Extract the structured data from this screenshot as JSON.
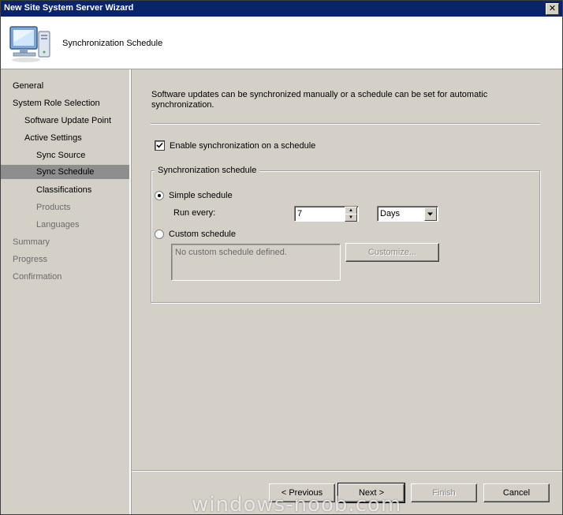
{
  "window": {
    "title": "New Site System Server Wizard",
    "close_glyph": "✕"
  },
  "header": {
    "title": "Synchronization Schedule",
    "icon": "computer-icon"
  },
  "nav": [
    {
      "label": "General",
      "state": "normal"
    },
    {
      "label": "System Role Selection",
      "state": "normal"
    },
    {
      "label": "Software Update Point",
      "state": "normal"
    },
    {
      "label": "Active Settings",
      "state": "normal"
    },
    {
      "label": "Sync Source",
      "state": "normal"
    },
    {
      "label": "Sync Schedule",
      "state": "selected"
    },
    {
      "label": "Classifications",
      "state": "normal"
    },
    {
      "label": "Products",
      "state": "dim"
    },
    {
      "label": "Languages",
      "state": "dim"
    },
    {
      "label": "Summary",
      "state": "dim"
    },
    {
      "label": "Progress",
      "state": "dim"
    },
    {
      "label": "Confirmation",
      "state": "dim"
    }
  ],
  "content": {
    "intro": "Software updates can be synchronized manually or a schedule can be set for automatic synchronization.",
    "enable_sync": {
      "label": "Enable synchronization on a schedule",
      "checked": true
    },
    "group_title": "Synchronization schedule",
    "simple": {
      "label": "Simple schedule",
      "selected": true
    },
    "run_every_label": "Run every:",
    "run_every_value": "7",
    "unit": "Days",
    "custom": {
      "label": "Custom schedule",
      "selected": false
    },
    "custom_text": "No custom schedule defined.",
    "customize_button": "Customize..."
  },
  "buttons": {
    "previous": "< Previous",
    "next": "Next >",
    "finish": "Finish",
    "cancel": "Cancel"
  },
  "watermark": "windows-noob.com",
  "colors": {
    "titlebar": "#0a246a",
    "selected_nav": "#8e8e8e",
    "window_bg": "#d4d0c8"
  }
}
